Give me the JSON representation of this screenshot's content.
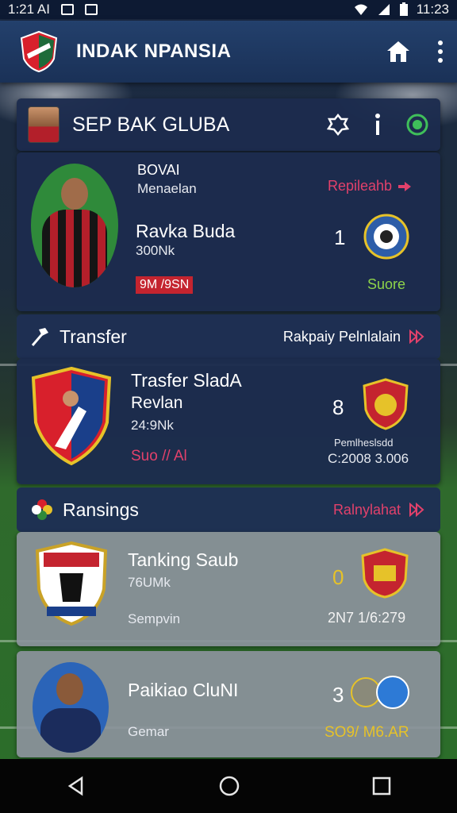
{
  "status_bar": {
    "time_left": "1:21 AI",
    "time_right": "11:23"
  },
  "app_bar": {
    "title": "INDAK NPANSIA"
  },
  "club_header": {
    "title": "SEP BAK GLUBA"
  },
  "featured": {
    "name": "BOVAI",
    "role": "Menaelan",
    "link": "Repileahb",
    "player_name": "Ravka Buda",
    "value": "300Nk",
    "tag": "9M /9SN",
    "score": "1",
    "club_label": "Suore"
  },
  "transfer": {
    "header_label": "Transfer",
    "header_link": "Rakpaiy Pelnlalain",
    "title": "Trasfer SladA",
    "player": "Revlan",
    "value": "24:9Nk",
    "tag": "Suo // Al",
    "score": "8",
    "meta_label": "Pemlheslsdd",
    "meta_value": "C:2008 3.006"
  },
  "rankings": {
    "header_label": "Ransings",
    "header_link": "Ralnylahat",
    "items": [
      {
        "title": "Tanking Saub",
        "value": "76UMk",
        "sub": "Sempvin",
        "score": "0",
        "meta": "2N7 1/6:279"
      },
      {
        "title": "Paikiao CluNI",
        "value": "",
        "sub": "Gemar",
        "score": "3",
        "meta": "SO9/ M6.AR"
      }
    ]
  },
  "colors": {
    "accent_red": "#e2416b",
    "accent_yellow": "#e6c229",
    "green_score": "#8ed44a"
  }
}
